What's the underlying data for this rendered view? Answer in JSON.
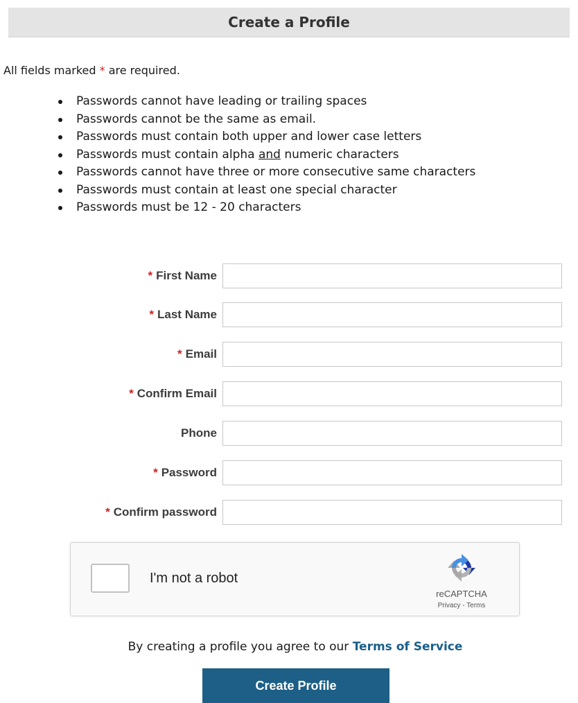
{
  "header": {
    "title": "Create a Profile"
  },
  "required_note": {
    "prefix": "All fields marked",
    "star": "*",
    "suffix": "are required."
  },
  "password_rules": [
    "Passwords cannot have leading or trailing spaces",
    "Passwords cannot be the same as email.",
    "Passwords must contain both upper and lower case letters",
    {
      "before": "Passwords must contain alpha ",
      "underlined": "and",
      "after": " numeric characters"
    },
    "Passwords cannot have three or more consecutive same characters",
    "Passwords must contain at least one special character",
    "Passwords must be 12 - 20 characters"
  ],
  "form": {
    "fields": [
      {
        "label": "First Name",
        "required": true,
        "value": ""
      },
      {
        "label": "Last Name",
        "required": true,
        "value": ""
      },
      {
        "label": "Email",
        "required": true,
        "value": ""
      },
      {
        "label": "Confirm Email",
        "required": true,
        "value": ""
      },
      {
        "label": "Phone",
        "required": false,
        "value": ""
      },
      {
        "label": "Password",
        "required": true,
        "value": ""
      },
      {
        "label": "Confirm password",
        "required": true,
        "value": ""
      }
    ],
    "required_marker": "*"
  },
  "captcha": {
    "label": "I'm not a robot",
    "brand": "reCAPTCHA",
    "links": "Privacy - Terms",
    "checked": false,
    "colors": {
      "blue": "#1c3aa9",
      "light_blue": "#4a90e2",
      "grey": "#b3b3b3"
    }
  },
  "agreement": {
    "text": "By creating a profile you agree to our",
    "link": "Terms of Service"
  },
  "submit": {
    "label": "Create Profile"
  },
  "colors": {
    "accent": "#1d5f86",
    "required_star": "#d02020",
    "header_bg": "#e4e4e4",
    "link": "#1a5f8a"
  },
  "icons": {
    "captcha_logo": "recaptcha-logo-icon"
  }
}
